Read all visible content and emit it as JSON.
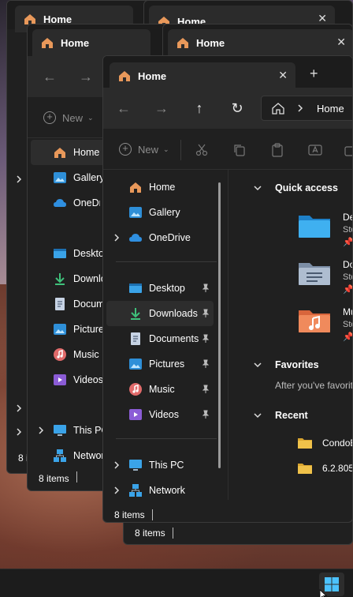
{
  "tab_title": "Home",
  "address": {
    "segment": "Home"
  },
  "command": {
    "new_label": "New"
  },
  "sidebar": {
    "home": "Home",
    "gallery": "Gallery",
    "onedrive": "OneDrive",
    "desktop": "Desktop",
    "downloads": "Downloads",
    "documents": "Documents",
    "pictures": "Pictures",
    "music": "Music",
    "videos": "Videos",
    "thispc": "This PC",
    "network": "Network"
  },
  "back_windows": {
    "w2": {
      "downloads": "Downlo",
      "documents": "Docum",
      "pictures": "Pictures",
      "onedrive": "OneDriv",
      "thispc": "This PC",
      "network": "Network",
      "status": "8 items"
    },
    "w1": {
      "status": "8 i"
    }
  },
  "status": "8 items",
  "quick_access": {
    "heading": "Quick access",
    "items": [
      {
        "name": "De",
        "sub": "Sto"
      },
      {
        "name": "Do",
        "sub": "Sto"
      },
      {
        "name": "Mu",
        "sub": "Sto"
      }
    ]
  },
  "favorites": {
    "heading": "Favorites",
    "empty_text": "After you've favorit"
  },
  "recent": {
    "heading": "Recent",
    "items": [
      {
        "name": "CondoB"
      },
      {
        "name": "6.2.805"
      }
    ]
  },
  "colors": {
    "accent": "#0078d4",
    "window_bg": "#202020",
    "folder_yellow": "#f0c24a"
  }
}
